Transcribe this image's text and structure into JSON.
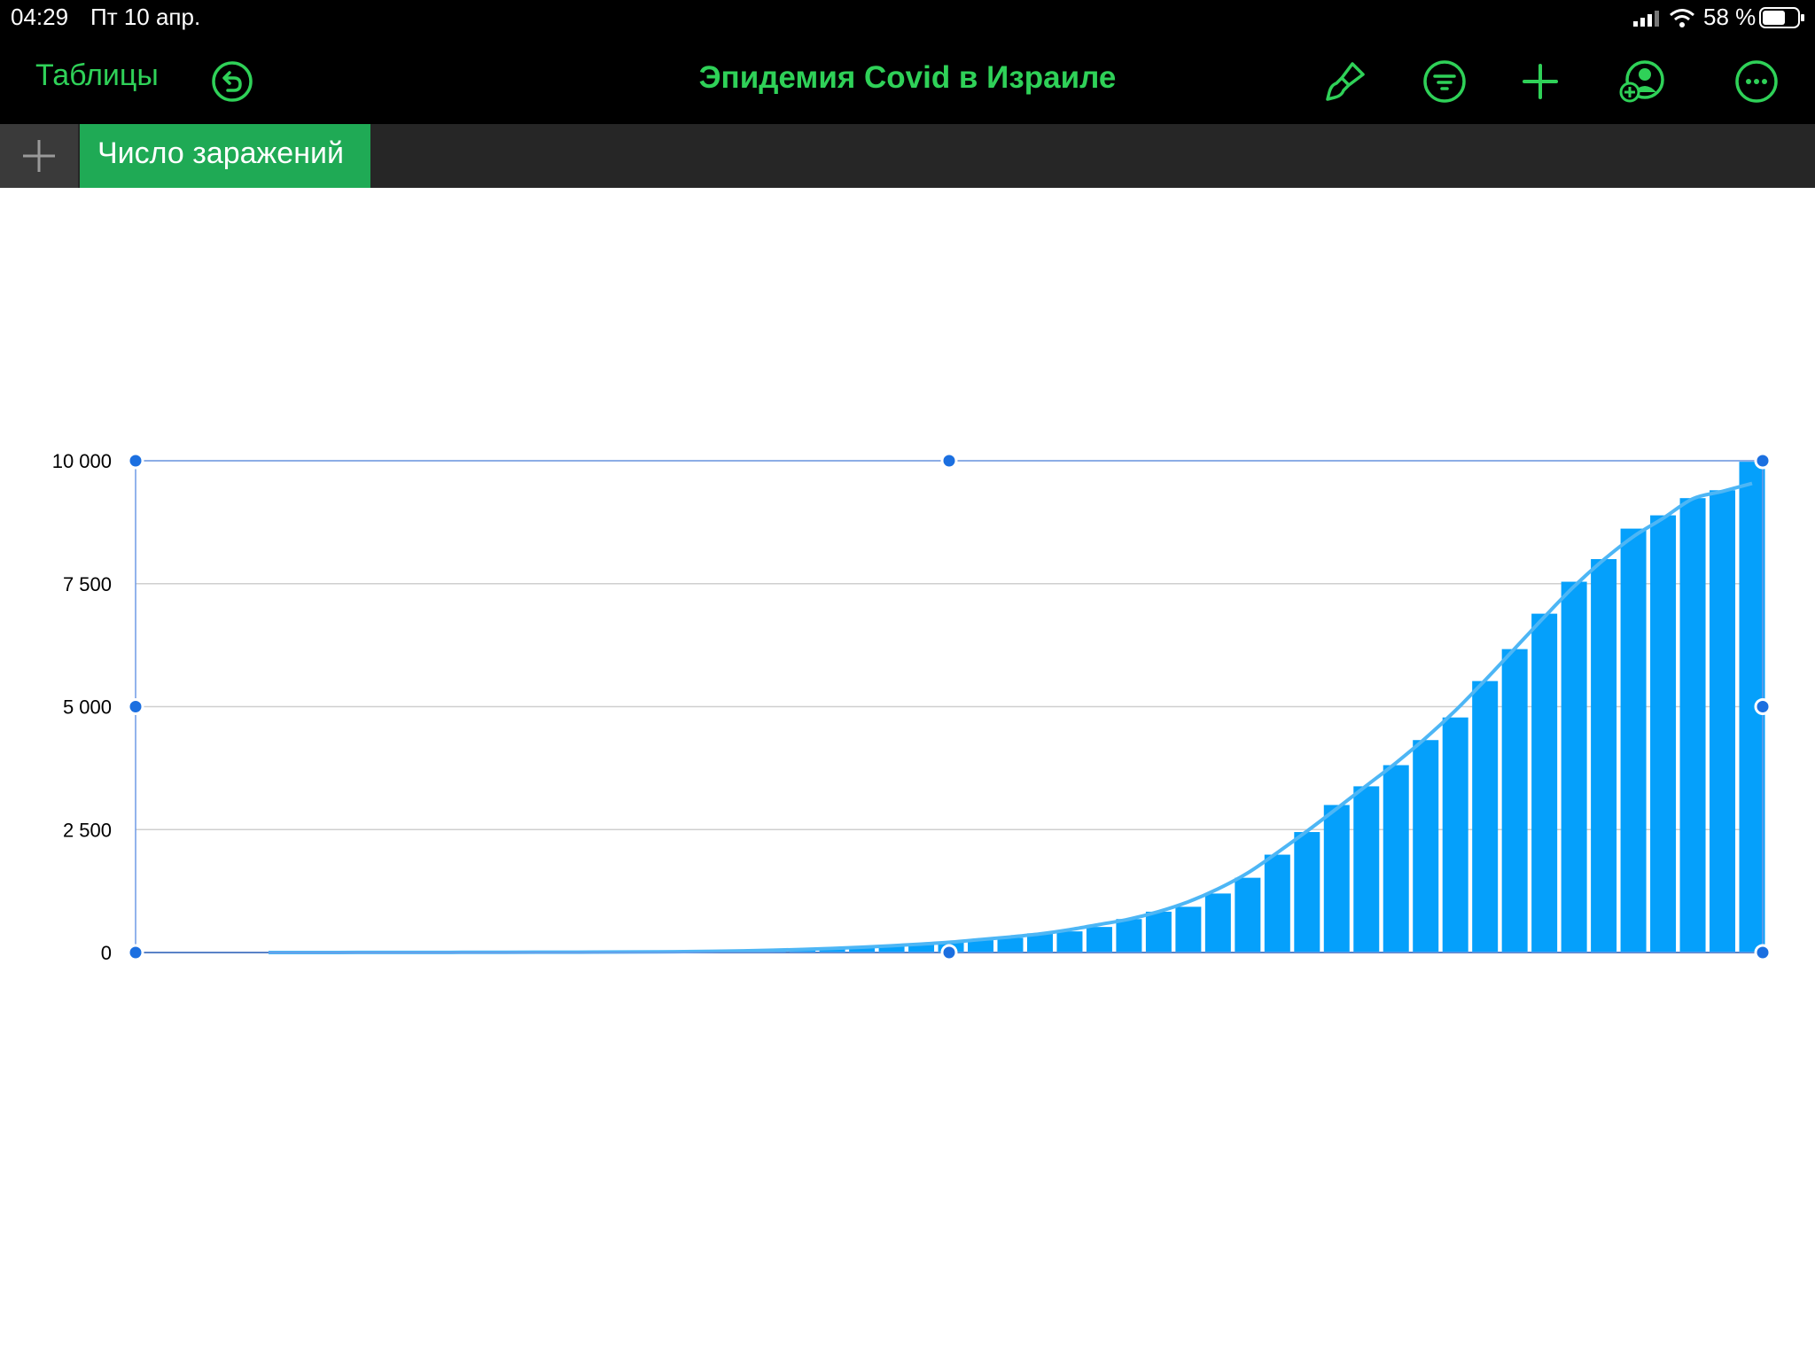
{
  "status_bar": {
    "time": "04:29",
    "date": "Пт 10 апр.",
    "battery": "58 %"
  },
  "toolbar": {
    "back_label": "Таблицы",
    "title": "Эпидемия Covid в Израиле",
    "accent_color": "#2fd158",
    "icons": [
      "undo-icon",
      "paintbrush-icon",
      "filter-icon",
      "plus-icon",
      "add-person-icon",
      "more-icon"
    ]
  },
  "sheets": {
    "tabs": [
      {
        "label": "Число заражений",
        "active": true
      }
    ],
    "active_color": "#1faa55"
  },
  "chart_data": {
    "type": "bar",
    "trendline": "smooth",
    "bar_color": "#05a0fb",
    "trend_color": "#4db6f5",
    "ylim": [
      0,
      10000
    ],
    "y_ticks": [
      "0",
      "2 500",
      "5 000",
      "7 500",
      "10 000"
    ],
    "grid": true,
    "selected": true,
    "values": [
      0,
      0,
      1,
      1,
      2,
      2,
      3,
      4,
      5,
      6,
      7,
      8,
      9,
      12,
      15,
      20,
      30,
      45,
      60,
      80,
      100,
      130,
      170,
      210,
      250,
      300,
      390,
      430,
      520,
      680,
      830,
      930,
      1200,
      1520,
      1990,
      2450,
      3000,
      3380,
      3810,
      4320,
      4780,
      5520,
      6170,
      6890,
      7540,
      8000,
      8620,
      8890,
      9240,
      9400,
      9980
    ]
  }
}
